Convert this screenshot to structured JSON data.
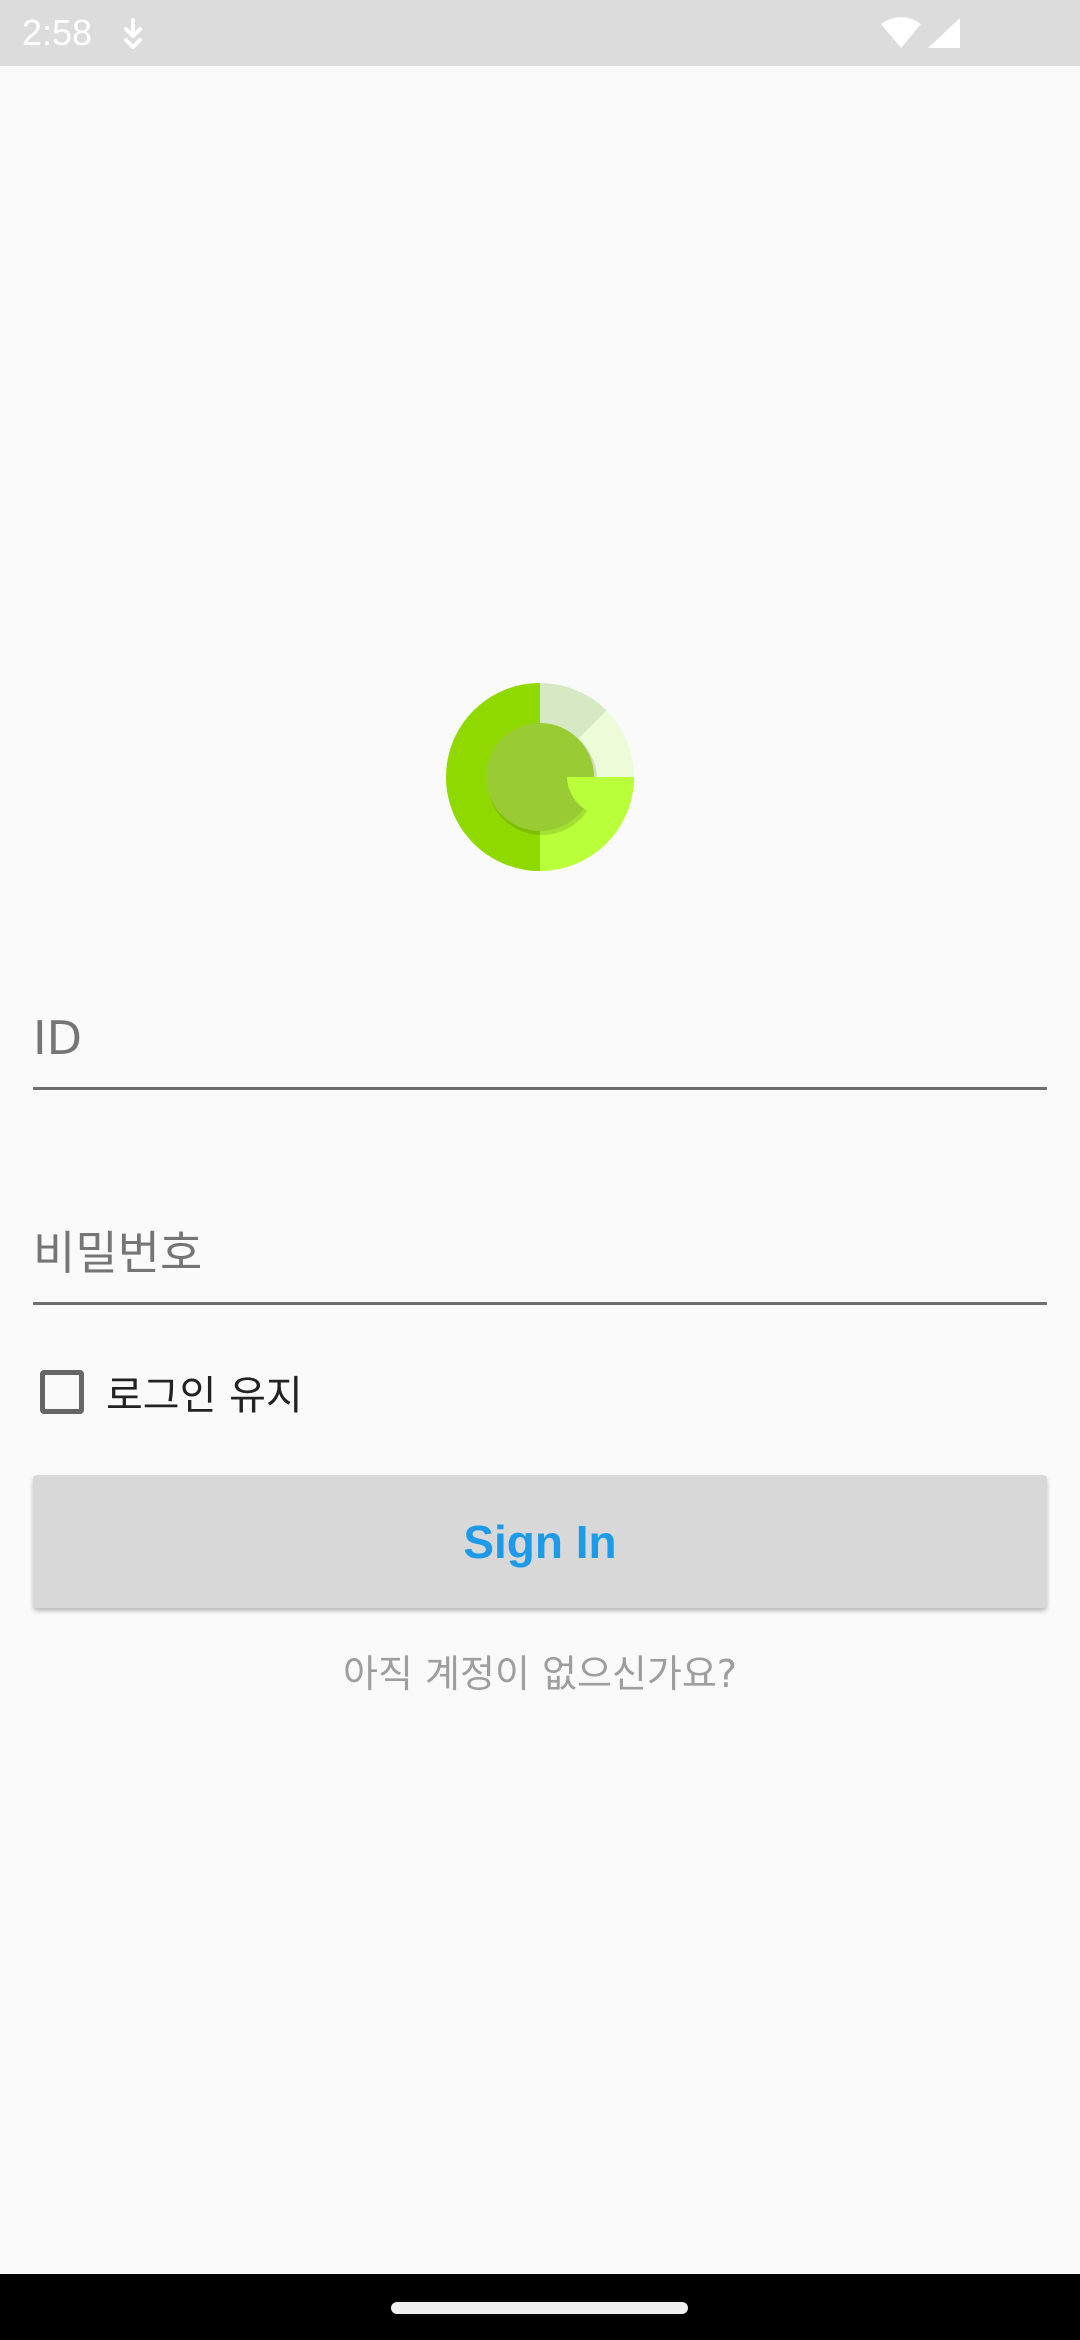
{
  "status_bar": {
    "time": "2:58",
    "notification_icon": "download-notification-icon",
    "wifi_icon": "wifi-icon",
    "signal_icon": "cellular-signal-icon"
  },
  "logo": {
    "icon": "app-logo-icon",
    "colors": {
      "left_half": "#8fd900",
      "bottom_right": "#b9ff3a",
      "top_right_light": "#d6e9c4",
      "top_right_lighter": "#ecfbd8",
      "center": "#99cc33"
    }
  },
  "form": {
    "id_placeholder": "ID",
    "id_value": "",
    "password_placeholder": "비밀번호",
    "password_value": "",
    "keep_login_label": "로그인 유지",
    "keep_login_checked": false,
    "sign_in_label": "Sign In",
    "signup_prompt": "아직 계정이 없으신가요?"
  },
  "colors": {
    "background": "#fafafa",
    "button_background": "#d8d8d8",
    "button_text": "#1e9be8",
    "link_text": "#9e9e9e"
  }
}
